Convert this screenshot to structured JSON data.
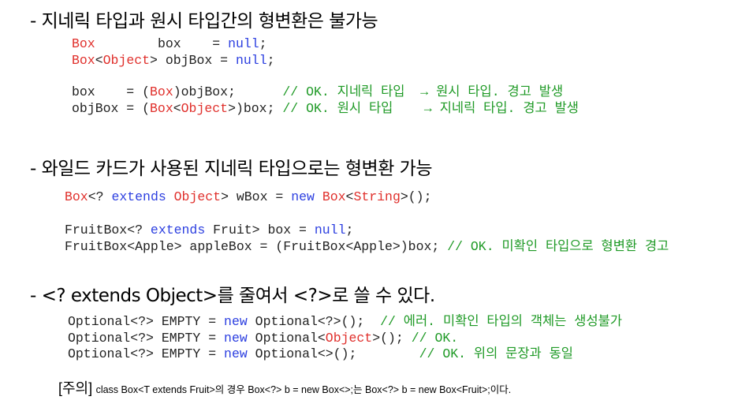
{
  "section1": {
    "heading": "- 지네릭 타입과 원시 타입간의 형변환은 불가능",
    "line1": {
      "type": "Box",
      "pad": "        ",
      "rest": "box    = ",
      "null": "null",
      "end": ";"
    },
    "line2": {
      "type": "Box",
      "lt": "<",
      "param": "Object",
      "gt": ">",
      "rest": " objBox = ",
      "null": "null",
      "end": ";"
    },
    "line3": {
      "a": "box    = (",
      "type": "Box",
      "b": ")objBox;      ",
      "comment": "// OK. 지네릭 타입  → 원시 타입. 경고 발생"
    },
    "line4": {
      "a": "objBox = (",
      "type": "Box",
      "lt": "<",
      "param": "Object",
      "b": ">)box; ",
      "comment": "// OK. 원시 타입    → 지네릭 타입. 경고 발생"
    }
  },
  "section2": {
    "heading": "- 와일드 카드가 사용된 지네릭 타입으로는 형변환 가능",
    "line1": {
      "type": "Box",
      "a": "<? ",
      "extends": "extends",
      "sp": " ",
      "obj": "Object",
      "b": "> wBox = ",
      "new": "new",
      "sp2": " ",
      "type2": "Box",
      "c": "<",
      "str": "String",
      "d": ">();"
    },
    "line2": {
      "a": "FruitBox<? ",
      "extends": "extends",
      "b": " Fruit> box = ",
      "null": "null",
      "c": ";"
    },
    "line3": {
      "a": "FruitBox<Apple> appleBox = (FruitBox<Apple>)box; ",
      "comment": "// OK. 미확인 타입으로 형변환 경고"
    }
  },
  "section3": {
    "heading": "- <? extends Object>를 줄여서 <?>로 쓸 수 있다.",
    "line1": {
      "a": "Optional<?> EMPTY = ",
      "new": "new",
      "b": " Optional<?>();  ",
      "comment": "// 에러. 미확인 타입의 객체는 생성불가"
    },
    "line2": {
      "a": "Optional<?> EMPTY = ",
      "new": "new",
      "b": " Optional<",
      "obj": "Object",
      "c": ">(); ",
      "comment": "// OK."
    },
    "line3": {
      "a": "Optional<?> EMPTY = ",
      "new": "new",
      "b": " Optional<>();        ",
      "comment": "// OK. 위의 문장과 동일"
    }
  },
  "note": {
    "tag": "[주의]",
    "text": "class Box<T extends Fruit>의 경우 Box<?> b = new Box<>;는 Box<?> b = new Box<Fruit>;이다."
  },
  "colors": {
    "type": "#e0302c",
    "keyword": "#2c3fe0",
    "comment": "#1f9a26"
  }
}
